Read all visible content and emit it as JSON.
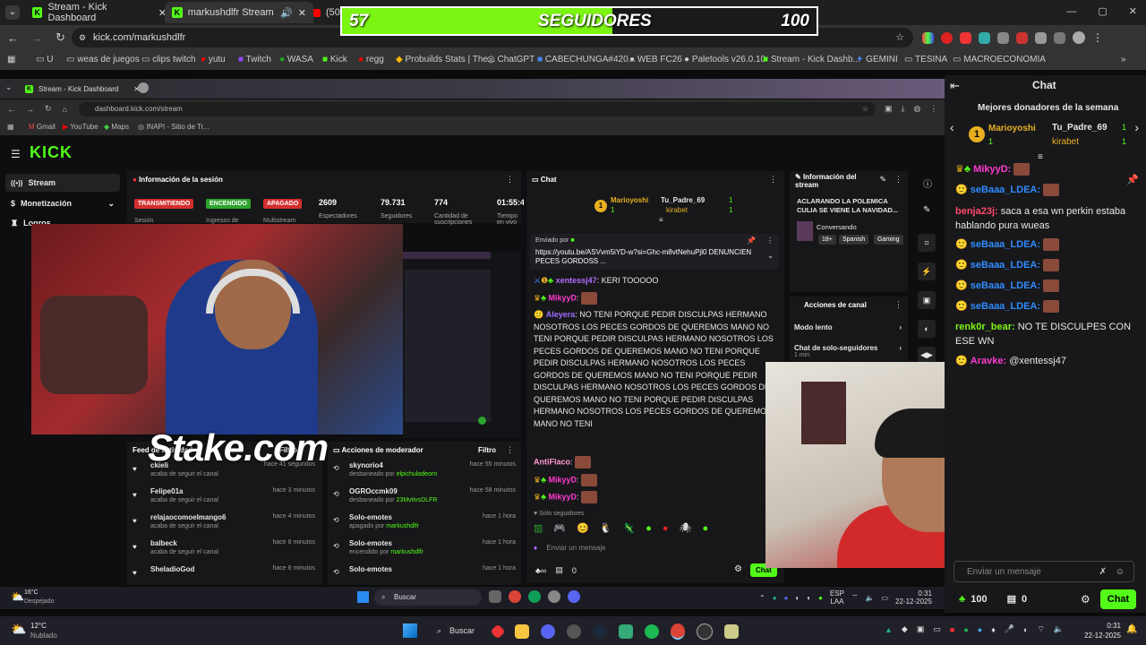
{
  "outer_browser": {
    "tabs": [
      {
        "title": "Stream - Kick Dashboard",
        "active": false
      },
      {
        "title": "markushdlfr Stream - Watc",
        "active": true
      },
      {
        "title": "(508",
        "active": false
      }
    ],
    "url": "kick.com/markushdlfr",
    "bookmarks": [
      "U",
      "weas de juegos",
      "clips twitch",
      "yutu",
      "Twitch",
      "WASA",
      "Kick",
      "regg",
      "Probuilds Stats | The...",
      "ChatGPT",
      "CABECHUNGA#420...",
      "WEB FC26",
      "Paletools v26.0.10",
      "Stream - Kick Dashb...",
      "GEMINI",
      "TESINA",
      "MACROECONOMIA"
    ]
  },
  "goal": {
    "current": "57",
    "label": "SEGUIDORES",
    "target": "100",
    "progress": 0.57
  },
  "inner_browser": {
    "tab": "Stream - Kick Dashboard",
    "url": "dashboard.kick.com/stream",
    "bookmarks": [
      "Gmail",
      "YouTube",
      "Maps",
      "INAPI - Sitio de Tr..."
    ]
  },
  "dashboard": {
    "logo": "KICK",
    "nav": [
      {
        "label": "Stream"
      },
      {
        "label": "Monetización"
      },
      {
        "label": "Logros"
      }
    ],
    "session": {
      "title": "Información de la sesión",
      "chips": [
        "TRANSMITIENDO",
        "ENCENDIDO",
        "APAGADO"
      ],
      "chip_labels": [
        "Sesión",
        "Ingresos de",
        "Multistream"
      ],
      "stats": [
        {
          "value": "2609",
          "label": "Espectadores"
        },
        {
          "value": "79.731",
          "label": "Seguidores"
        },
        {
          "value": "774",
          "label": "Cantidad de suscripciones"
        },
        {
          "value": "01:55:4",
          "label": "Tiempo en vivo"
        }
      ]
    },
    "chat": {
      "title": "Chat",
      "donors": [
        {
          "name": "Marioyoshi",
          "amount": "1"
        },
        {
          "name": "Tu_Padre_69",
          "amount": "1"
        },
        {
          "name": "kirabet",
          "amount": "1"
        }
      ],
      "pinned_by": "Enviado por",
      "pinned_link": "https://youtu.be/ASVvm5iYD-w?si=Ghc-m8vtNehuPjl0 DENUNCIEN PECES GORDOSS ...",
      "messages": [
        {
          "user": "xentessj47",
          "text": "KERI TOOOOO",
          "color": "#b36bff"
        },
        {
          "user": "MikyyD",
          "text": "",
          "color": "#ff3ad0"
        },
        {
          "user": "Aleyera",
          "text": "NO TENI PORQUE PEDIR DISCULPAS HERMANO NOSOTROS LOS PECES GORDOS DE QUEREMOS MANO NO TENI PORQUE PEDIR DISCULPAS HERMANO NOSOTROS LOS PECES GORDOS DE QUEREMOS MANO NO TENI PORQUE PEDIR DISCULPAS HERMANO NOSOTROS LOS PECES GORDOS DE QUEREMOS MANO NO TENI PORQUE PEDIR DISCULPAS HERMANO NOSOTROS LOS PECES GORDOS DE QUEREMOS MANO NO TENI PORQUE PEDIR DISCULPAS HERMANO NOSOTROS LOS PECES GORDOS DE QUEREMOS MANO NO TENI",
          "color": "#9b6bff"
        },
        {
          "user": "AntiFlaco",
          "text": "",
          "color": "#ff9ad0"
        },
        {
          "user": "MikyyD",
          "text": "",
          "color": "#ff3ad0"
        },
        {
          "user": "MikyyD",
          "text": "",
          "color": "#ff3ad0"
        }
      ],
      "followers_only": "Solo seguidores",
      "input_placeholder": "Enviar un mensaje",
      "count": "0",
      "send": "Chat"
    },
    "stream_info": {
      "title": "Información del stream",
      "stream_title": "ACLARANDO LA POLEMICA CULIA SE VIENE LA NAVIDAD...",
      "category": "Conversando",
      "tags": [
        "18+",
        "Spanish",
        "Gaming"
      ]
    },
    "channel_actions": {
      "title": "Acciones de canal",
      "items": [
        {
          "label": "Modo lento"
        },
        {
          "label": "Chat de solo-seguidores",
          "sub": "1 min"
        }
      ]
    },
    "activity": {
      "title": "Feed de actividad",
      "filter": "Filtro",
      "items": [
        {
          "user": "ckieli",
          "action": "acaba de seguir el canal",
          "time": "hace 41 segundos"
        },
        {
          "user": "Felipe01a",
          "action": "acaba de seguir el canal",
          "time": "hace 3 minutos"
        },
        {
          "user": "relajaocomoelmango6",
          "action": "acaba de seguir el canal",
          "time": "hace 4 minutos"
        },
        {
          "user": "balbeck",
          "action": "acaba de seguir el canal",
          "time": "hace 8 minutos"
        },
        {
          "user": "SheladioGod",
          "action": "",
          "time": "hace 8 minutos"
        }
      ]
    },
    "mod_actions": {
      "title": "Acciones de moderador",
      "filter": "Filtro",
      "items": [
        {
          "user": "skynorio4",
          "action": "desbaneado por",
          "by": "elpichuladeoro",
          "time": "hace 55 minutos"
        },
        {
          "user": "OGROccmk09",
          "action": "desbaneado por",
          "by": "23MvtivsDLFR",
          "time": "hace 58 minutos"
        },
        {
          "user": "Solo-emotes",
          "action": "apagado por",
          "by": "markushdlfr",
          "time": "hace 1 hora"
        },
        {
          "user": "Solo-emotes",
          "action": "encendido por",
          "by": "markushdlfr",
          "time": "hace 1 hora"
        },
        {
          "user": "Solo-emotes",
          "action": "",
          "by": "",
          "time": "hace 1 hora"
        }
      ]
    }
  },
  "watermark": "Stake.com",
  "right_chat": {
    "title": "Chat",
    "donors_title": "Mejores donadores de la semana",
    "donors": [
      {
        "name": "Marioyoshi",
        "amount": "1"
      },
      {
        "name": "Tu_Padre_69",
        "amount": "1"
      },
      {
        "name": "kirabet",
        "amount": "1"
      }
    ],
    "messages": [
      {
        "user": "MikyyD:",
        "text": "",
        "color": "#ff3ad0"
      },
      {
        "user": "seBaaa_LDEA:",
        "text": "",
        "color": "#2f8bff"
      },
      {
        "user": "benja23j:",
        "text": "saca a esa wn perkin estaba",
        "cont": "hablando pura wueas",
        "color": "#ff4a6a"
      },
      {
        "user": "seBaaa_LDEA:",
        "text": "",
        "color": "#2f8bff"
      },
      {
        "user": "seBaaa_LDEA:",
        "text": "",
        "color": "#2f8bff"
      },
      {
        "user": "seBaaa_LDEA:",
        "text": "",
        "color": "#2f8bff"
      },
      {
        "user": "seBaaa_LDEA:",
        "text": "",
        "color": "#2f8bff"
      },
      {
        "user": "renk0r_bear:",
        "text": "NO TE DISCULPES CON",
        "cont": "ESE WN",
        "color": "#7cf512"
      },
      {
        "user": "Aravke:",
        "text": "@xentessj47",
        "color": "#ff3ad0"
      }
    ],
    "input_placeholder": "Enviar un mensaje",
    "points": "100",
    "count": "0",
    "send": "Chat"
  },
  "inner_taskbar": {
    "weather_temp": "16°C",
    "weather": "Despejado",
    "search": "Buscar",
    "lang": "ESP",
    "lang2": "LAA",
    "time": "0:31",
    "date": "22-12-2025"
  },
  "taskbar": {
    "weather_temp": "12°C",
    "weather": "Nublado",
    "search": "Buscar",
    "time": "0:31",
    "date": "22-12-2025"
  }
}
